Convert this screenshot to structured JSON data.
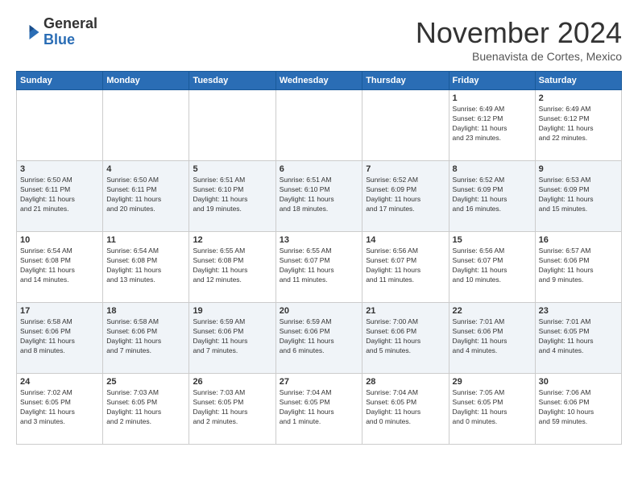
{
  "logo": {
    "general": "General",
    "blue": "Blue"
  },
  "title": {
    "month": "November 2024",
    "location": "Buenavista de Cortes, Mexico"
  },
  "headers": [
    "Sunday",
    "Monday",
    "Tuesday",
    "Wednesday",
    "Thursday",
    "Friday",
    "Saturday"
  ],
  "weeks": [
    [
      {
        "day": "",
        "info": ""
      },
      {
        "day": "",
        "info": ""
      },
      {
        "day": "",
        "info": ""
      },
      {
        "day": "",
        "info": ""
      },
      {
        "day": "",
        "info": ""
      },
      {
        "day": "1",
        "info": "Sunrise: 6:49 AM\nSunset: 6:12 PM\nDaylight: 11 hours\nand 23 minutes."
      },
      {
        "day": "2",
        "info": "Sunrise: 6:49 AM\nSunset: 6:12 PM\nDaylight: 11 hours\nand 22 minutes."
      }
    ],
    [
      {
        "day": "3",
        "info": "Sunrise: 6:50 AM\nSunset: 6:11 PM\nDaylight: 11 hours\nand 21 minutes."
      },
      {
        "day": "4",
        "info": "Sunrise: 6:50 AM\nSunset: 6:11 PM\nDaylight: 11 hours\nand 20 minutes."
      },
      {
        "day": "5",
        "info": "Sunrise: 6:51 AM\nSunset: 6:10 PM\nDaylight: 11 hours\nand 19 minutes."
      },
      {
        "day": "6",
        "info": "Sunrise: 6:51 AM\nSunset: 6:10 PM\nDaylight: 11 hours\nand 18 minutes."
      },
      {
        "day": "7",
        "info": "Sunrise: 6:52 AM\nSunset: 6:09 PM\nDaylight: 11 hours\nand 17 minutes."
      },
      {
        "day": "8",
        "info": "Sunrise: 6:52 AM\nSunset: 6:09 PM\nDaylight: 11 hours\nand 16 minutes."
      },
      {
        "day": "9",
        "info": "Sunrise: 6:53 AM\nSunset: 6:09 PM\nDaylight: 11 hours\nand 15 minutes."
      }
    ],
    [
      {
        "day": "10",
        "info": "Sunrise: 6:54 AM\nSunset: 6:08 PM\nDaylight: 11 hours\nand 14 minutes."
      },
      {
        "day": "11",
        "info": "Sunrise: 6:54 AM\nSunset: 6:08 PM\nDaylight: 11 hours\nand 13 minutes."
      },
      {
        "day": "12",
        "info": "Sunrise: 6:55 AM\nSunset: 6:08 PM\nDaylight: 11 hours\nand 12 minutes."
      },
      {
        "day": "13",
        "info": "Sunrise: 6:55 AM\nSunset: 6:07 PM\nDaylight: 11 hours\nand 11 minutes."
      },
      {
        "day": "14",
        "info": "Sunrise: 6:56 AM\nSunset: 6:07 PM\nDaylight: 11 hours\nand 11 minutes."
      },
      {
        "day": "15",
        "info": "Sunrise: 6:56 AM\nSunset: 6:07 PM\nDaylight: 11 hours\nand 10 minutes."
      },
      {
        "day": "16",
        "info": "Sunrise: 6:57 AM\nSunset: 6:06 PM\nDaylight: 11 hours\nand 9 minutes."
      }
    ],
    [
      {
        "day": "17",
        "info": "Sunrise: 6:58 AM\nSunset: 6:06 PM\nDaylight: 11 hours\nand 8 minutes."
      },
      {
        "day": "18",
        "info": "Sunrise: 6:58 AM\nSunset: 6:06 PM\nDaylight: 11 hours\nand 7 minutes."
      },
      {
        "day": "19",
        "info": "Sunrise: 6:59 AM\nSunset: 6:06 PM\nDaylight: 11 hours\nand 7 minutes."
      },
      {
        "day": "20",
        "info": "Sunrise: 6:59 AM\nSunset: 6:06 PM\nDaylight: 11 hours\nand 6 minutes."
      },
      {
        "day": "21",
        "info": "Sunrise: 7:00 AM\nSunset: 6:06 PM\nDaylight: 11 hours\nand 5 minutes."
      },
      {
        "day": "22",
        "info": "Sunrise: 7:01 AM\nSunset: 6:06 PM\nDaylight: 11 hours\nand 4 minutes."
      },
      {
        "day": "23",
        "info": "Sunrise: 7:01 AM\nSunset: 6:05 PM\nDaylight: 11 hours\nand 4 minutes."
      }
    ],
    [
      {
        "day": "24",
        "info": "Sunrise: 7:02 AM\nSunset: 6:05 PM\nDaylight: 11 hours\nand 3 minutes."
      },
      {
        "day": "25",
        "info": "Sunrise: 7:03 AM\nSunset: 6:05 PM\nDaylight: 11 hours\nand 2 minutes."
      },
      {
        "day": "26",
        "info": "Sunrise: 7:03 AM\nSunset: 6:05 PM\nDaylight: 11 hours\nand 2 minutes."
      },
      {
        "day": "27",
        "info": "Sunrise: 7:04 AM\nSunset: 6:05 PM\nDaylight: 11 hours\nand 1 minute."
      },
      {
        "day": "28",
        "info": "Sunrise: 7:04 AM\nSunset: 6:05 PM\nDaylight: 11 hours\nand 0 minutes."
      },
      {
        "day": "29",
        "info": "Sunrise: 7:05 AM\nSunset: 6:05 PM\nDaylight: 11 hours\nand 0 minutes."
      },
      {
        "day": "30",
        "info": "Sunrise: 7:06 AM\nSunset: 6:06 PM\nDaylight: 10 hours\nand 59 minutes."
      }
    ]
  ]
}
